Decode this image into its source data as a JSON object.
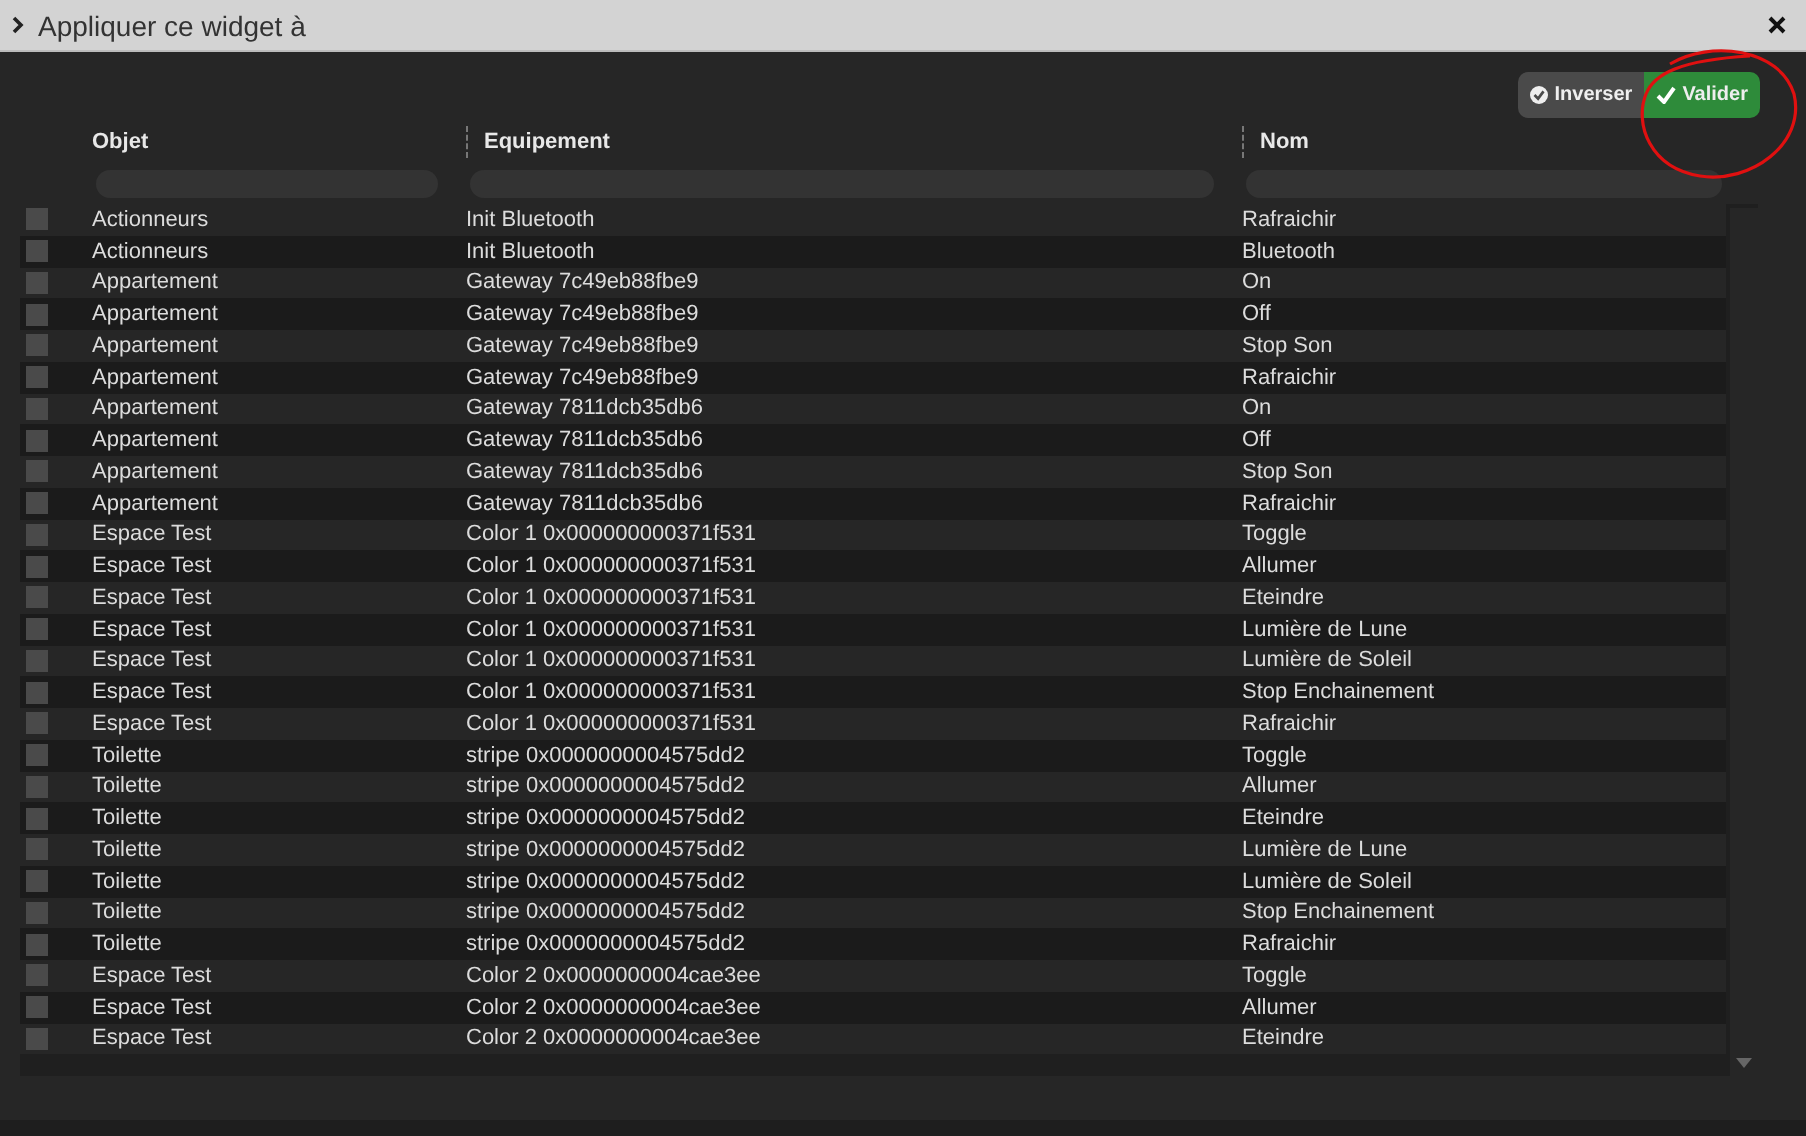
{
  "window": {
    "title": "Appliquer ce widget à"
  },
  "actions": [
    {
      "kind": "secondary",
      "label": "Inverser"
    },
    {
      "kind": "primary",
      "label": "Valider"
    }
  ],
  "table": {
    "columns": [
      "Objet",
      "Equipement",
      "Nom"
    ],
    "rows": [
      {
        "checked": false,
        "cells": [
          "Actionneurs",
          "Init Bluetooth",
          "Rafraichir"
        ]
      },
      {
        "checked": false,
        "cells": [
          "Actionneurs",
          "Init Bluetooth",
          "Bluetooth"
        ]
      },
      {
        "checked": false,
        "cells": [
          "Appartement",
          "Gateway 7c49eb88fbe9",
          "On"
        ]
      },
      {
        "checked": false,
        "cells": [
          "Appartement",
          "Gateway 7c49eb88fbe9",
          "Off"
        ]
      },
      {
        "checked": false,
        "cells": [
          "Appartement",
          "Gateway 7c49eb88fbe9",
          "Stop Son"
        ]
      },
      {
        "checked": false,
        "cells": [
          "Appartement",
          "Gateway 7c49eb88fbe9",
          "Rafraichir"
        ]
      },
      {
        "checked": false,
        "cells": [
          "Appartement",
          "Gateway 7811dcb35db6",
          "On"
        ]
      },
      {
        "checked": false,
        "cells": [
          "Appartement",
          "Gateway 7811dcb35db6",
          "Off"
        ]
      },
      {
        "checked": false,
        "cells": [
          "Appartement",
          "Gateway 7811dcb35db6",
          "Stop Son"
        ]
      },
      {
        "checked": false,
        "cells": [
          "Appartement",
          "Gateway 7811dcb35db6",
          "Rafraichir"
        ]
      },
      {
        "checked": false,
        "cells": [
          "Espace Test",
          "Color 1 0x000000000371f531",
          "Toggle"
        ]
      },
      {
        "checked": false,
        "cells": [
          "Espace Test",
          "Color 1 0x000000000371f531",
          "Allumer"
        ]
      },
      {
        "checked": false,
        "cells": [
          "Espace Test",
          "Color 1 0x000000000371f531",
          "Eteindre"
        ]
      },
      {
        "checked": false,
        "cells": [
          "Espace Test",
          "Color 1 0x000000000371f531",
          "Lumière de Lune"
        ]
      },
      {
        "checked": false,
        "cells": [
          "Espace Test",
          "Color 1 0x000000000371f531",
          "Lumière de Soleil"
        ]
      },
      {
        "checked": false,
        "cells": [
          "Espace Test",
          "Color 1 0x000000000371f531",
          "Stop Enchainement"
        ]
      },
      {
        "checked": false,
        "cells": [
          "Espace Test",
          "Color 1 0x000000000371f531",
          "Rafraichir"
        ]
      },
      {
        "checked": false,
        "cells": [
          "Toilette",
          "stripe 0x0000000004575dd2",
          "Toggle"
        ]
      },
      {
        "checked": false,
        "cells": [
          "Toilette",
          "stripe 0x0000000004575dd2",
          "Allumer"
        ]
      },
      {
        "checked": false,
        "cells": [
          "Toilette",
          "stripe 0x0000000004575dd2",
          "Eteindre"
        ]
      },
      {
        "checked": false,
        "cells": [
          "Toilette",
          "stripe 0x0000000004575dd2",
          "Lumière de Lune"
        ]
      },
      {
        "checked": false,
        "cells": [
          "Toilette",
          "stripe 0x0000000004575dd2",
          "Lumière de Soleil"
        ]
      },
      {
        "checked": false,
        "cells": [
          "Toilette",
          "stripe 0x0000000004575dd2",
          "Stop Enchainement"
        ]
      },
      {
        "checked": false,
        "cells": [
          "Toilette",
          "stripe 0x0000000004575dd2",
          "Rafraichir"
        ]
      },
      {
        "checked": false,
        "cells": [
          "Espace Test",
          "Color 2 0x0000000004cae3ee",
          "Toggle"
        ]
      },
      {
        "checked": false,
        "cells": [
          "Espace Test",
          "Color 2 0x0000000004cae3ee",
          "Allumer"
        ]
      },
      {
        "checked": false,
        "cells": [
          "Espace Test",
          "Color 2 0x0000000004cae3ee",
          "Eteindre"
        ]
      }
    ]
  }
}
